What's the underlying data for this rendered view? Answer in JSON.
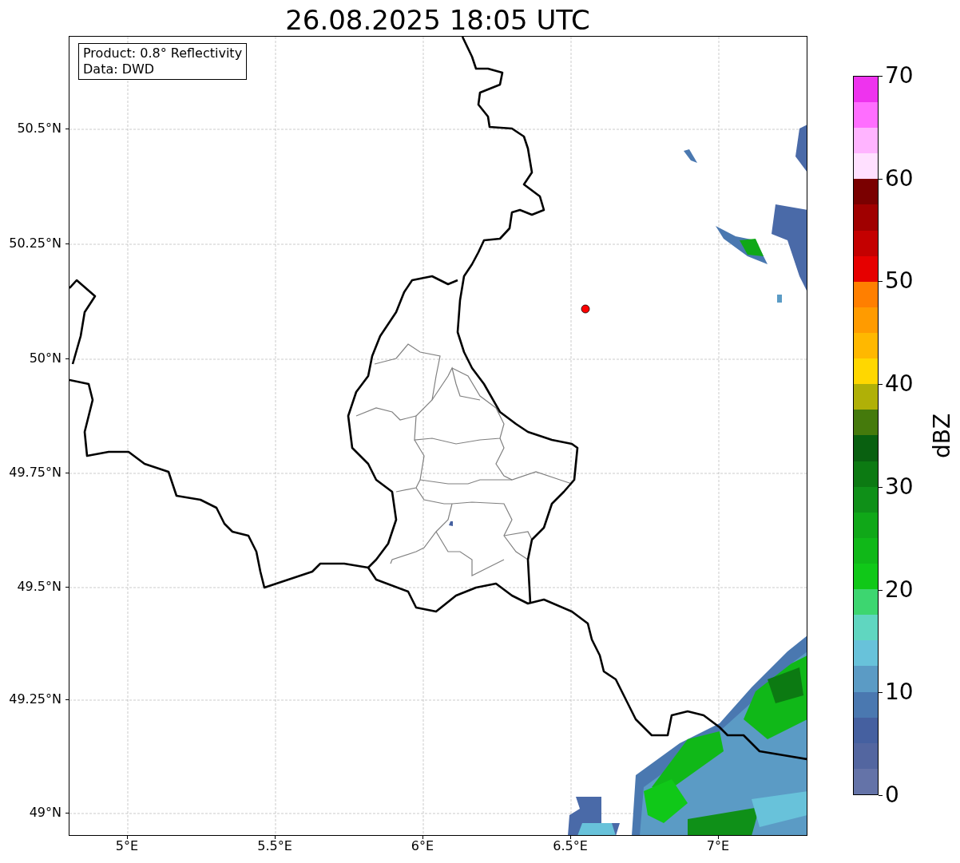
{
  "title": "26.08.2025 18:05 UTC",
  "info_box": [
    "Product: 0.8° Reflectivity",
    "Data: DWD"
  ],
  "map": {
    "lat_labels": [
      "50.5°N",
      "50.25°N",
      "50°N",
      "49.75°N",
      "49.5°N",
      "49.25°N",
      "49°N"
    ],
    "lon_labels": [
      "5°E",
      "5.5°E",
      "6°E",
      "6.5°E",
      "7°E"
    ]
  },
  "colorbar": {
    "label": "dBZ",
    "tick_labels": [
      "70",
      "60",
      "50",
      "40",
      "30",
      "20",
      "10",
      "0"
    ],
    "bins": [
      {
        "color": "#6473a8"
      },
      {
        "color": "#5366a0"
      },
      {
        "color": "#4560a0"
      },
      {
        "color": "#4a78b0"
      },
      {
        "color": "#5b9bc5"
      },
      {
        "color": "#68c2da"
      },
      {
        "color": "#60d6c0"
      },
      {
        "color": "#3dd670"
      },
      {
        "color": "#10c818"
      },
      {
        "color": "#10b818"
      },
      {
        "color": "#10a818"
      },
      {
        "color": "#0f9018"
      },
      {
        "color": "#0c7a12"
      },
      {
        "color": "#096010"
      },
      {
        "color": "#457a0c"
      },
      {
        "color": "#b0b007"
      },
      {
        "color": "#ffd700"
      },
      {
        "color": "#ffb800"
      },
      {
        "color": "#ff9b00"
      },
      {
        "color": "#ff7f00"
      },
      {
        "color": "#e60000"
      },
      {
        "color": "#c40000"
      },
      {
        "color": "#a00000"
      },
      {
        "color": "#7a0000"
      },
      {
        "color": "#ffe0ff"
      },
      {
        "color": "#ffb4ff"
      },
      {
        "color": "#ff6eff"
      },
      {
        "color": "#ee33ee"
      }
    ]
  }
}
